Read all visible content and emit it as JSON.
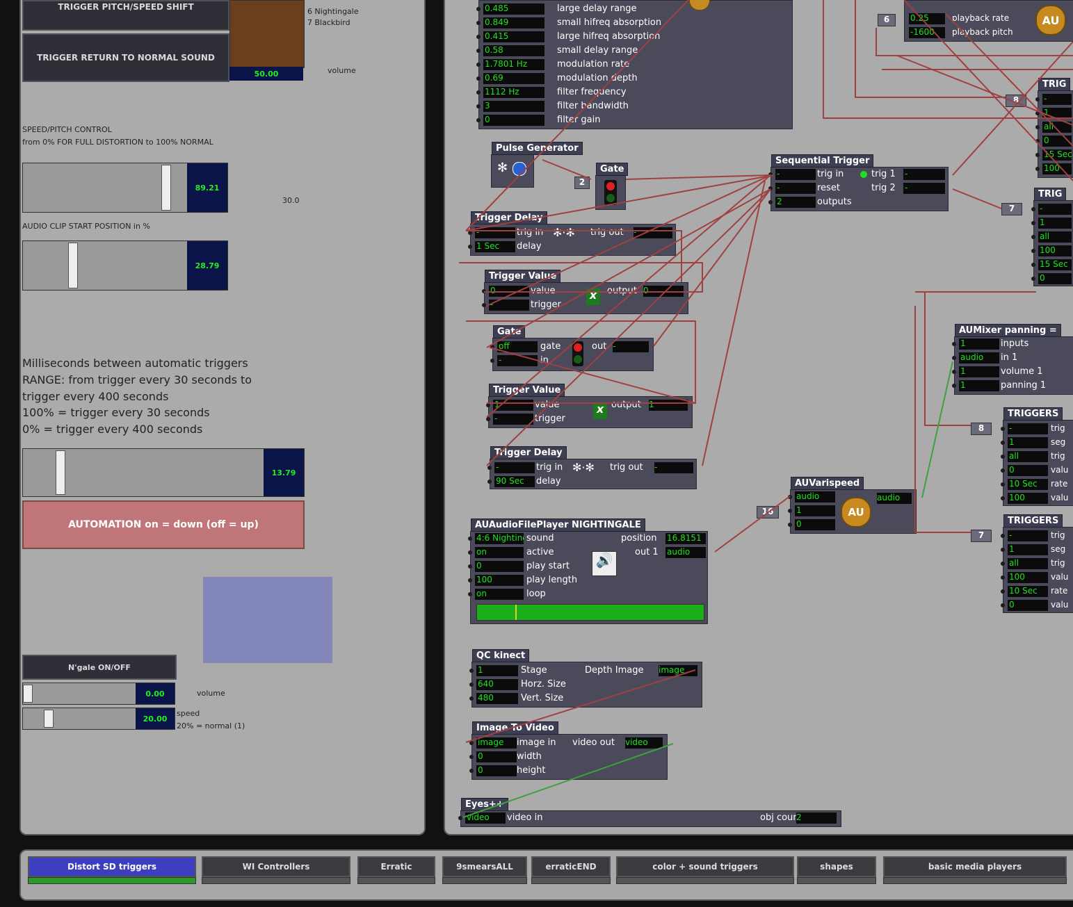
{
  "left": {
    "top_button": "TRIGGER PITCH/SPEED SHIFT",
    "return_button": "TRIGGER RETURN TO NORMAL SOUND",
    "bird_list": [
      "6 Nightingale",
      "7 Blackbird"
    ],
    "brown_value": "50.00",
    "volume_label": "volume",
    "speed_title": "SPEED/PITCH CONTROL",
    "speed_sub": "from 0% FOR FULL DISTORTION to 100% NORMAL",
    "speed_value": "89.21",
    "speed_level": 0.89,
    "side_value": "30.0",
    "clip_label": "AUDIO CLIP START POSITION in %",
    "clip_value": "28.79",
    "clip_level": 0.29,
    "ms_lines": [
      "Milliseconds between automatic triggers",
      "RANGE: from trigger every 30 seconds to",
      "trigger every 400 seconds",
      "100% = trigger every 30 seconds",
      "0% = trigger every 400 seconds"
    ],
    "auto_value": "13.79",
    "auto_level": 0.14,
    "automation_button": "AUTOMATION on = down (off = up)",
    "ngale_button": "N'gale ON/OFF",
    "ngale_volume_value": "0.00",
    "ngale_volume_level": 0.0,
    "ngale_volume_label": "volume",
    "ngale_speed_value": "20.00",
    "ngale_speed_level": 0.2,
    "ngale_speed_label": "speed",
    "ngale_speed_note": "20%  = normal (1)",
    "swatch_color": "#8286b8"
  },
  "reverb": {
    "rows": [
      {
        "v": "0.485",
        "l": "large delay range"
      },
      {
        "v": "0.849",
        "l": "small hifreq absorption"
      },
      {
        "v": "0.415",
        "l": "large hifreq absorption"
      },
      {
        "v": "0.58",
        "l": "small delay range"
      },
      {
        "v": "1.7801 Hz",
        "l": "modulation rate"
      },
      {
        "v": "0.69",
        "l": "modulation depth"
      },
      {
        "v": "1112 Hz",
        "l": "filter frequency"
      },
      {
        "v": "3",
        "l": "filter bandwidth"
      },
      {
        "v": "0",
        "l": "filter gain"
      }
    ]
  },
  "playback": {
    "badge": "6",
    "rows": [
      {
        "v": "0.25",
        "l": "playback rate"
      },
      {
        "v": "-1600",
        "l": "playback pitch"
      }
    ],
    "au_icon": "AU"
  },
  "pulse": {
    "title": "Pulse Generator"
  },
  "gate1": {
    "title": "Gate",
    "in": "2"
  },
  "seq": {
    "title": "Sequential Trigger",
    "rows": [
      {
        "v": "-",
        "l": "trig in"
      },
      {
        "v": "-",
        "l": "reset"
      },
      {
        "v": "2",
        "l": "outputs"
      }
    ],
    "outs": [
      {
        "l": "trig 1",
        "v": "-"
      },
      {
        "l": "trig 2",
        "v": "-"
      }
    ]
  },
  "tdelay1": {
    "title": "Trigger Delay",
    "rows": [
      {
        "v": "-",
        "l": "trig in"
      },
      {
        "v": "1 Sec",
        "l": "delay"
      }
    ],
    "out_label": "trig out",
    "out_val": "-"
  },
  "tvalue1": {
    "title": "Trigger Value",
    "rows": [
      {
        "v": "0",
        "l": "value"
      },
      {
        "v": "-",
        "l": "trigger"
      }
    ],
    "out_label": "output",
    "out_val": "0"
  },
  "gate2": {
    "title": "Gate",
    "rows": [
      {
        "v": "off",
        "l": "gate"
      },
      {
        "v": "-",
        "l": "in"
      }
    ],
    "out_label": "out",
    "out_val": "-"
  },
  "tvalue2": {
    "title": "Trigger Value",
    "rows": [
      {
        "v": "1",
        "l": "value"
      },
      {
        "v": "-",
        "l": "trigger"
      }
    ],
    "out_label": "output",
    "out_val": "1"
  },
  "tdelay2": {
    "title": "Trigger Delay",
    "rows": [
      {
        "v": "-",
        "l": "trig in"
      },
      {
        "v": "90 Sec",
        "l": "delay"
      }
    ],
    "out_label": "trig out",
    "out_val": "-"
  },
  "player": {
    "title": "AUAudioFilePlayer NIGHTINGALE",
    "rows": [
      {
        "v": "4:6 Nightingale",
        "l": "sound"
      },
      {
        "v": "on",
        "l": "active"
      },
      {
        "v": "0",
        "l": "play start"
      },
      {
        "v": "100",
        "l": "play length"
      },
      {
        "v": "on",
        "l": "loop"
      }
    ],
    "outs": [
      {
        "l": "position",
        "v": "16.8151"
      },
      {
        "l": "out 1",
        "v": "audio"
      }
    ],
    "progress": 0.17
  },
  "varispeed": {
    "title": "AUVarispeed",
    "badge": "16",
    "rows": [
      {
        "v": "audio"
      },
      {
        "v": "1"
      },
      {
        "v": "0"
      }
    ],
    "out_val": "audio",
    "au_icon": "AU"
  },
  "kinect": {
    "title": "QC kinect",
    "rows": [
      {
        "v": "1",
        "l": "Stage"
      },
      {
        "v": "640",
        "l": "Horz. Size"
      },
      {
        "v": "480",
        "l": "Vert. Size"
      }
    ],
    "out_label": "Depth Image",
    "out_val": "image"
  },
  "itv": {
    "title": "Image To Video",
    "rows": [
      {
        "v": "image",
        "l": "image in"
      },
      {
        "v": "0",
        "l": "width"
      },
      {
        "v": "0",
        "l": "height"
      }
    ],
    "out_label": "video out",
    "out_val": "video"
  },
  "eyes": {
    "title": "Eyes++",
    "rows": [
      {
        "v": "video",
        "l": "video in"
      }
    ],
    "out_label": "obj count",
    "out_val": "2"
  },
  "mixer": {
    "title": "AUMixer panning =",
    "rows": [
      {
        "v": "1",
        "l": "inputs"
      },
      {
        "v": "audio",
        "l": "in 1"
      },
      {
        "v": "1",
        "l": "volume 1"
      },
      {
        "v": "1",
        "l": "panning 1"
      }
    ]
  },
  "trig_top": {
    "title": "TRIG",
    "badge": "8",
    "rows": [
      "-",
      "1",
      "all",
      "0",
      "15 Sec",
      "100"
    ]
  },
  "trig_mid": {
    "title": "TRIG",
    "badge": "7",
    "rows": [
      "-",
      "1",
      "all",
      "100",
      "15 Sec",
      "0"
    ]
  },
  "triggers1": {
    "title": "TRIGGERS",
    "badge": "8",
    "rows": [
      {
        "v": "-",
        "l": "trig"
      },
      {
        "v": "1",
        "l": "seg"
      },
      {
        "v": "all",
        "l": "trig"
      },
      {
        "v": "0",
        "l": "valu"
      },
      {
        "v": "10 Sec",
        "l": "rate"
      },
      {
        "v": "100",
        "l": "valu"
      }
    ]
  },
  "triggers2": {
    "title": "TRIGGERS",
    "badge": "7",
    "rows": [
      {
        "v": "-",
        "l": "trig"
      },
      {
        "v": "1",
        "l": "seg"
      },
      {
        "v": "all",
        "l": "trig"
      },
      {
        "v": "100",
        "l": "valu"
      },
      {
        "v": "10 Sec",
        "l": "rate"
      },
      {
        "v": "0",
        "l": "valu"
      }
    ]
  },
  "tabs": [
    {
      "label": "Distort SD triggers",
      "active": true
    },
    {
      "label": "WI Controllers",
      "active": false
    },
    {
      "label": "Erratic",
      "active": false
    },
    {
      "label": "9smearsALL",
      "active": false
    },
    {
      "label": "erraticEND",
      "active": false
    },
    {
      "label": "color + sound triggers",
      "active": false
    },
    {
      "label": "shapes",
      "active": false
    },
    {
      "label": "basic media players",
      "active": false
    }
  ],
  "colors": {
    "wire_red": "#a04040",
    "wire_green": "#3fa03f",
    "value_green": "#20e020"
  }
}
